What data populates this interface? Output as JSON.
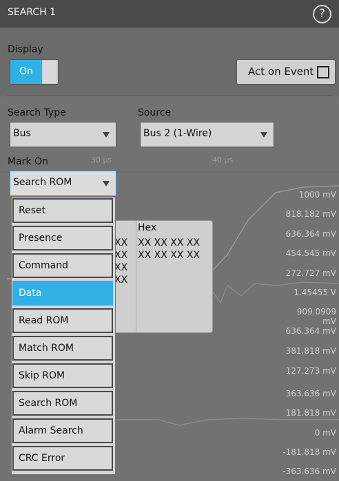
{
  "window": {
    "title": "SEARCH 1",
    "help_icon": "?"
  },
  "display": {
    "label": "Display",
    "toggle_state": "On"
  },
  "act_on_event": {
    "label": "Act on Event"
  },
  "search_type": {
    "label": "Search Type",
    "value": "Bus"
  },
  "source": {
    "label": "Source",
    "value": "Bus 2 (1-Wire)"
  },
  "mark_on": {
    "label": "Mark On",
    "value": "Search ROM",
    "options": [
      "Reset",
      "Presence",
      "Command",
      "Data",
      "Read ROM",
      "Match ROM",
      "Skip ROM",
      "Search ROM",
      "Alarm Search",
      "CRC Error"
    ],
    "highlighted": "Data"
  },
  "background": {
    "time_labels": [
      "30 µs",
      "40 µs"
    ],
    "y_labels": [
      "1000 mV",
      "818.182 mV",
      "636.364 mV",
      "454.545 mV",
      "272.727 mV",
      "1.45455 V",
      "909.0909 mV",
      "636.364 mV",
      "381.818 mV",
      "127.273 mV",
      "363.636 mV",
      "181.818 mV",
      "0 mV",
      "-181.818 mV",
      "-363.636 mV"
    ],
    "results_table": {
      "header": "Hex",
      "left_col_partial": [
        "XX",
        "XX",
        "XX",
        "XX"
      ],
      "rows": [
        "XX XX XX XX",
        "XX XX XX XX"
      ]
    }
  },
  "colors": {
    "accent": "#31b0e6",
    "titlebar": "#4a4a4a"
  }
}
